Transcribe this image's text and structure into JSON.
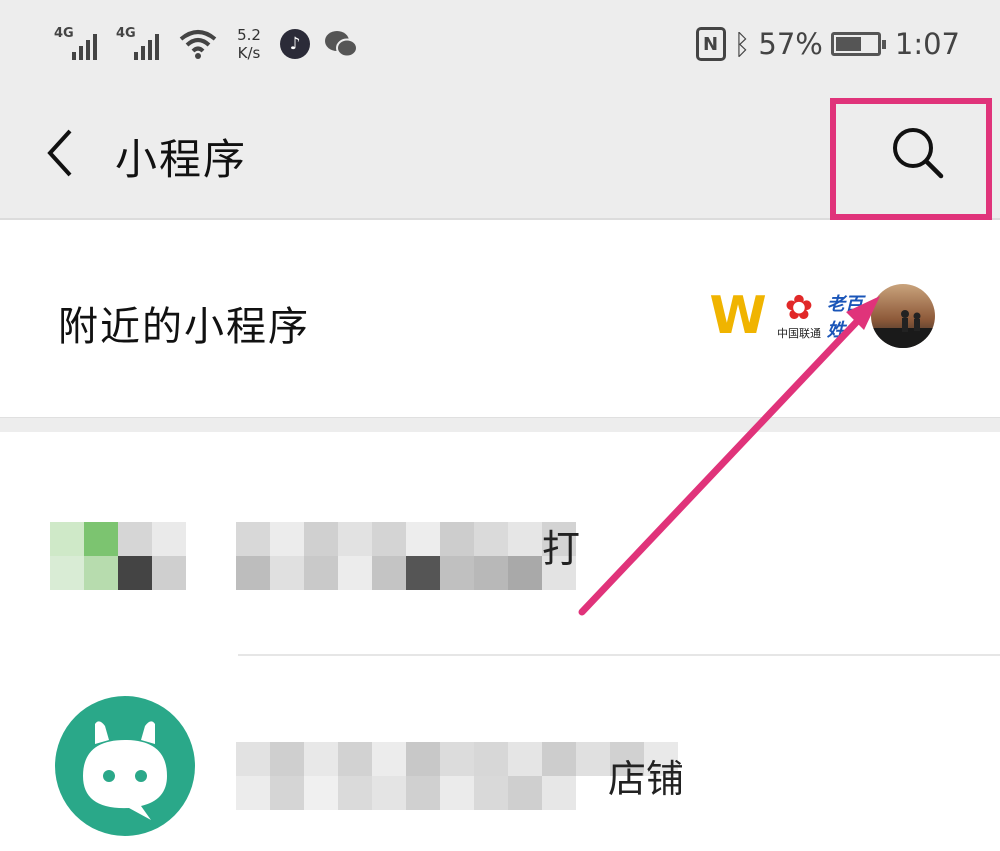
{
  "status_bar": {
    "network1": "4G",
    "network2": "4G",
    "speed_value": "5.2",
    "speed_unit": "K/s",
    "nfc": "N",
    "battery_percent": "57%",
    "battery_level": 0.57,
    "time": "1:07"
  },
  "header": {
    "title": "小程序"
  },
  "nearby": {
    "label": "附近的小程序",
    "thumbnails": [
      {
        "icon": "w-crown-logo",
        "text": "W"
      },
      {
        "icon": "china-unicom-logo",
        "text": "中国联通"
      },
      {
        "icon": "blue-brand-logo",
        "text": "老百姓"
      },
      {
        "icon": "sunset-photo",
        "text": ""
      }
    ]
  },
  "list": {
    "item1": {
      "icon": "blurred-app-icon",
      "visible_tail": "打"
    },
    "item2": {
      "icon": "green-chat-icon",
      "visible_tail": "店铺"
    }
  },
  "colors": {
    "header_bg": "#ededed",
    "highlight": "#e0337a",
    "green_icon": "#2aa889"
  }
}
